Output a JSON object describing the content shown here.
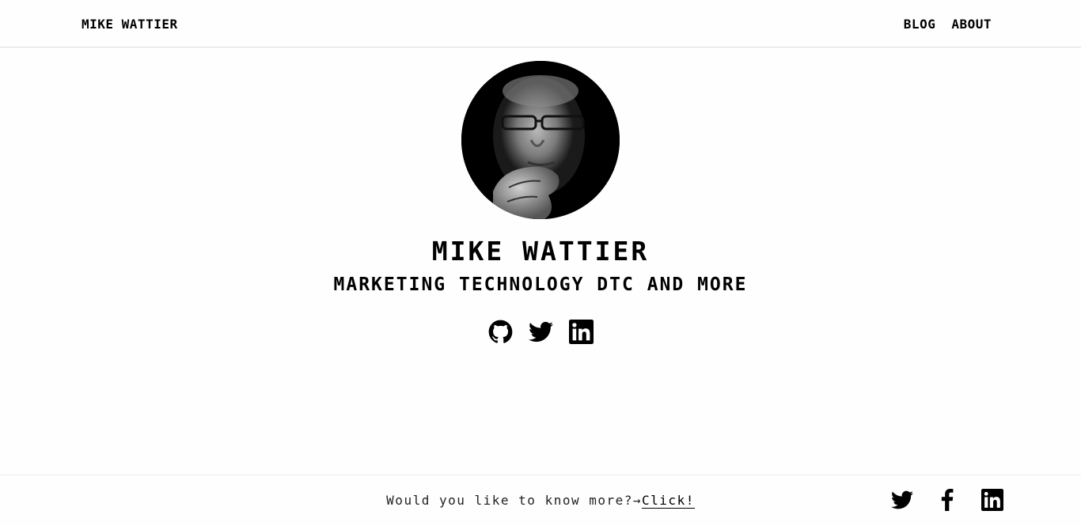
{
  "header": {
    "site_title": "MIKE WATTIER",
    "nav": [
      {
        "label": "BLOG"
      },
      {
        "label": "ABOUT"
      }
    ]
  },
  "hero": {
    "avatar_alt": "profile photo",
    "name": "MIKE WATTIER",
    "subtitle": "MARKETING TECHNOLOGY DTC AND MORE",
    "social_icons": [
      "github-icon",
      "twitter-icon",
      "linkedin-icon"
    ]
  },
  "footer": {
    "prompt": "Would you like to know more?→",
    "link_label": "Click!",
    "social_icons": [
      "twitter-icon",
      "facebook-icon",
      "linkedin-icon"
    ]
  },
  "colors": {
    "background": "#fefefe",
    "text": "#000000",
    "divider": "#dcdcdc"
  }
}
